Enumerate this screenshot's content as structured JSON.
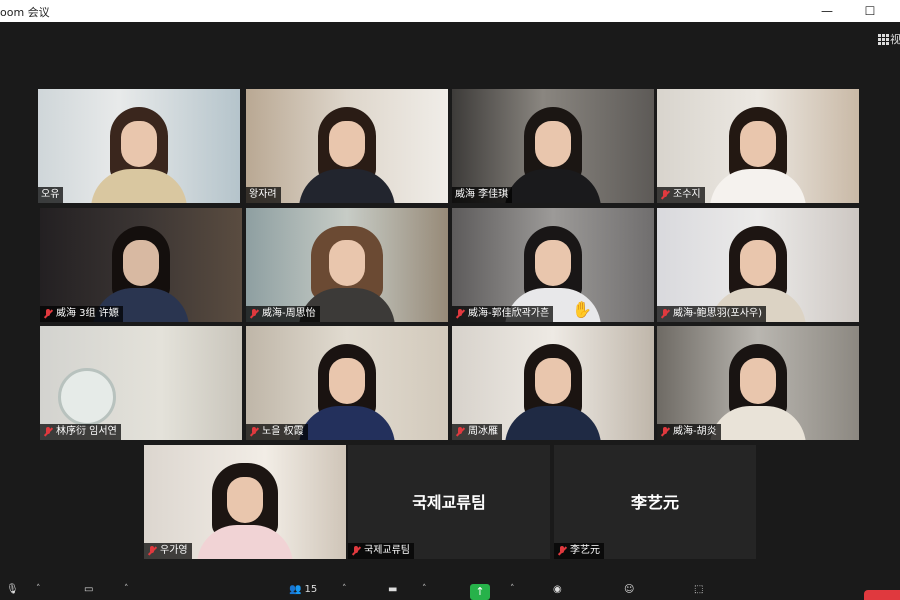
{
  "window": {
    "title": "oom 会议",
    "minimize_glyph": "—",
    "maximize_glyph": "☐"
  },
  "view_button": {
    "label": "视"
  },
  "participants": [
    {
      "name": "오유",
      "muted": false,
      "active": true
    },
    {
      "name": "왕자려",
      "muted": false
    },
    {
      "name": "威海 李佳琪",
      "muted": false
    },
    {
      "name": "조수지",
      "muted": true
    },
    {
      "name": "威海 3组 许嫄",
      "muted": true
    },
    {
      "name": "威海-周思怡",
      "muted": true
    },
    {
      "name": "威海-郭佳欣곽가흔",
      "muted": true,
      "hand_raised": true
    },
    {
      "name": "威海-鲍思羽(포사우)",
      "muted": true
    },
    {
      "name": "林序衍 임서연",
      "muted": true
    },
    {
      "name": "노을 权霞",
      "muted": true
    },
    {
      "name": "周冰雁",
      "muted": true
    },
    {
      "name": "威海-胡炎",
      "muted": true
    },
    {
      "name": "우가영",
      "muted": true
    },
    {
      "name": "국제교류팀",
      "muted": true,
      "video_off": true,
      "display_name": "국제교류팀"
    },
    {
      "name": "李艺元",
      "muted": true,
      "video_off": true,
      "display_name": "李艺元"
    }
  ],
  "toolbar": {
    "participants_count": "15",
    "colors": {
      "share": "#27b24a",
      "end": "#e0393e",
      "active_speaker": "#e5e04a"
    }
  }
}
